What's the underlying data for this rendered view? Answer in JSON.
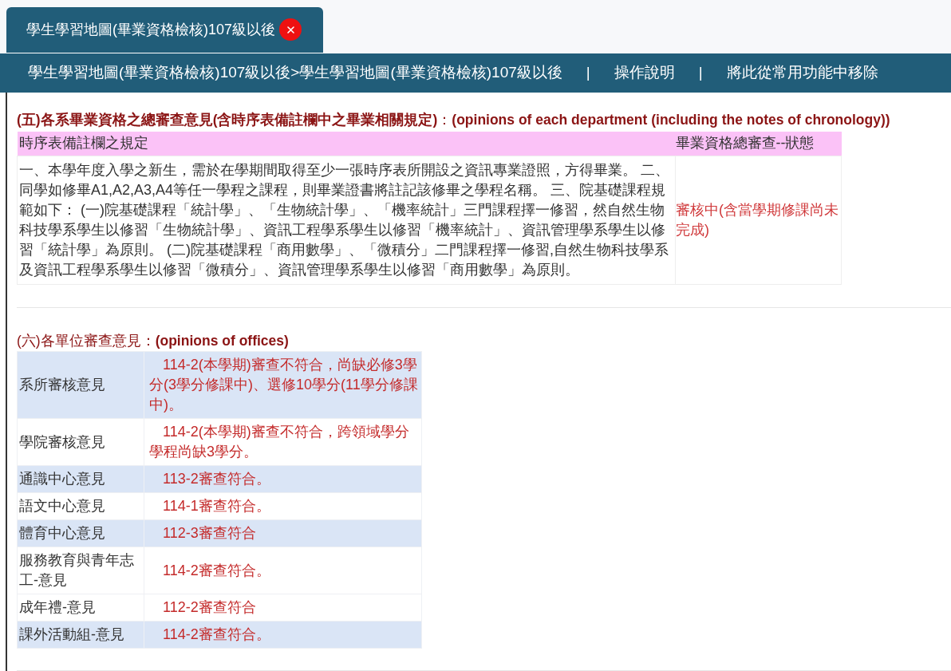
{
  "tabs": [
    {
      "label": "學生學習地圖(畢業資格檢核)107級以後",
      "selected": true
    }
  ],
  "nav_bar": {
    "breadcrumb": "學生學習地圖(畢業資格檢核)107級以後>學生學習地圖(畢業資格檢核)107級以後",
    "links": [
      {
        "separator": "|",
        "text": "操作說明"
      },
      {
        "separator": "|",
        "text": "將此從常用功能中移除"
      }
    ]
  },
  "sections": [
    {
      "kind": "rules_table",
      "heading": "**(五)各系畢業資格之總審查意見(含時序表備註欄中之畢業相關規定)**：**(opinions of each department (including the notes of chronology))**",
      "columns": [
        "時序表備註欄之規定",
        "畢業資格總審查--狀態"
      ],
      "rows": [
        {
          "rule": "一、本學年度入學之新生，需於在學期間取得至少一張時序表所開設之資訊專業證照，方得畢業。 二、同學如修畢A1,A2,A3,A4等任一學程之課程，則畢業證書將註記該修畢之學程名稱。 三、院基礎課程規範如下： (一)院基礎課程「統計學」、「生物統計學」、「機率統計」三門課程擇一修習，然自然生物科技學系學生以修習「生物統計學」、資訊工程學系學生以修習「機率統計」、資訊管理學系學生以修習「統計學」為原則。 (二)院基礎課程「商用數學」、「微積分」二門課程擇一修習,自然生物科技學系及資訊工程學系學生以修習「微積分」、資訊管理學系學生以修習「商用數學」為原則。",
          "status": "審核中(含當學期修課尚未完成)"
        }
      ]
    },
    {
      "kind": "opinions_table",
      "heading": "(六)各單位審查意見：**(opinions of offices)**",
      "rows": [
        {
          "unit": "系所審核意見",
          "opinion": "114-2(本學期)審查不符合，尚缺必修3學分(3學分修課中)、選修10學分(11學分修課中)。",
          "shaded": true
        },
        {
          "unit": "學院審核意見",
          "opinion": "114-2(本學期)審查不符合，跨領域學分學程尚缺3學分。",
          "shaded": false
        },
        {
          "unit": "通識中心意見",
          "opinion": "113-2審查符合。",
          "shaded": true
        },
        {
          "unit": "語文中心意見",
          "opinion": "114-1審查符合。",
          "shaded": false
        },
        {
          "unit": "體育中心意見",
          "opinion": "112-3審查符合",
          "shaded": true
        },
        {
          "unit": "服務教育與青年志工-意見",
          "opinion": "114-2審查符合。",
          "shaded": false
        },
        {
          "unit": "成年禮-意見",
          "opinion": "112-2審查符合",
          "shaded": false
        },
        {
          "unit": "課外活動組-意見",
          "opinion": "114-2審查符合。",
          "shaded": true
        }
      ]
    }
  ]
}
